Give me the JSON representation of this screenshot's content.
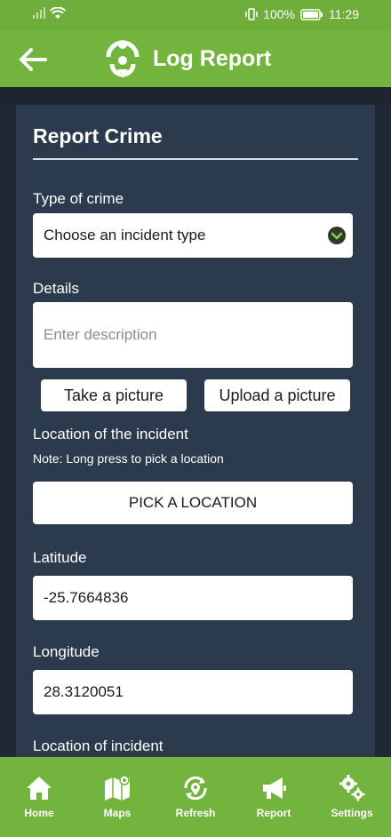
{
  "status_bar": {
    "battery": "100%",
    "time": "11:29"
  },
  "header": {
    "title": "Log Report"
  },
  "form": {
    "title": "Report Crime",
    "crime_type_label": "Type of crime",
    "crime_type_value": "Choose an incident type",
    "details_label": "Details",
    "details_placeholder": "Enter description",
    "take_picture": "Take a picture",
    "upload_picture": "Upload a picture",
    "location_label": "Location of the incident",
    "location_note": "Note: Long press to pick a location",
    "pick_location": "PICK A LOCATION",
    "latitude_label": "Latitude",
    "latitude_value": "-25.7664836",
    "longitude_label": "Longitude",
    "longitude_value": "28.3120051",
    "incident_location_label": "Location of incident"
  },
  "nav": [
    {
      "label": "Home",
      "icon": "home-icon"
    },
    {
      "label": "Maps",
      "icon": "map-icon"
    },
    {
      "label": "Refresh",
      "icon": "refresh-location-icon"
    },
    {
      "label": "Report",
      "icon": "megaphone-icon"
    },
    {
      "label": "Settings",
      "icon": "gears-icon"
    }
  ],
  "colors": {
    "accent": "#73b43e",
    "card": "#2b3a4c",
    "background": "#1f2935"
  }
}
